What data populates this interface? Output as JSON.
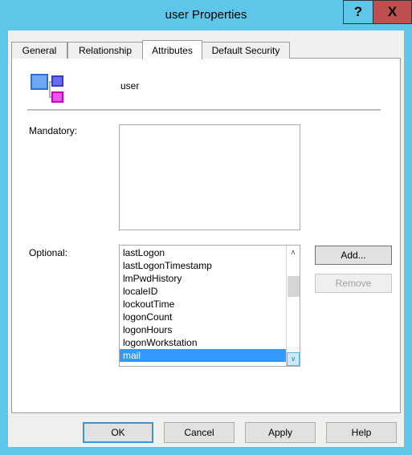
{
  "window": {
    "title": "user Properties",
    "help_button": "?",
    "close_button": "X",
    "accent_color": "#5EC6E8",
    "close_color": "#C0504D"
  },
  "tabs": [
    {
      "label": "General",
      "active": false
    },
    {
      "label": "Relationship",
      "active": false
    },
    {
      "label": "Attributes",
      "active": true
    },
    {
      "label": "Default Security",
      "active": false
    }
  ],
  "header": {
    "icon": "schema-class-icon",
    "class_name": "user"
  },
  "mandatory": {
    "label": "Mandatory:",
    "items": []
  },
  "optional": {
    "label": "Optional:",
    "items": [
      "lastLogon",
      "lastLogonTimestamp",
      "lmPwdHistory",
      "localeID",
      "lockoutTime",
      "logonCount",
      "logonHours",
      "logonWorkstation",
      "mail"
    ],
    "selected": "mail",
    "scrollbar": {
      "up_arrow": "∧",
      "down_arrow": "∨"
    }
  },
  "side_buttons": {
    "add": "Add...",
    "remove": "Remove"
  },
  "bottom_buttons": {
    "ok": "OK",
    "cancel": "Cancel",
    "apply": "Apply",
    "help": "Help"
  }
}
